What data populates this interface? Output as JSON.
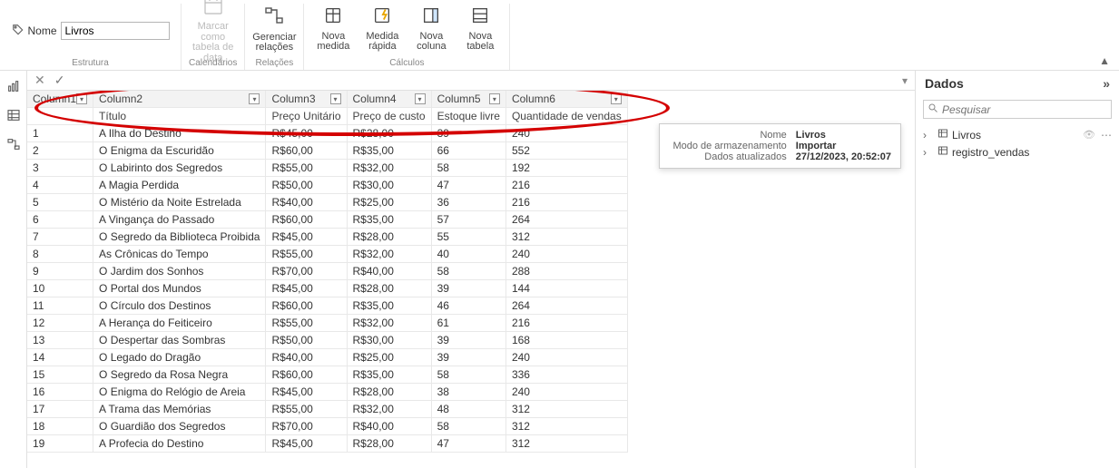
{
  "ribbon": {
    "name_label": "Nome",
    "name_value": "Livros",
    "groups": {
      "estrutura": "Estrutura",
      "calendarios": "Calendários",
      "relacoes": "Relações",
      "calculos": "Cálculos"
    },
    "buttons": {
      "marcar": "Marcar como tabela de data",
      "gerenciar": "Gerenciar relações",
      "nova_medida": "Nova medida",
      "medida_rapida": "Medida rápida",
      "nova_coluna": "Nova coluna",
      "nova_tabela": "Nova tabela"
    }
  },
  "columns": [
    "Column1",
    "Column2",
    "Column3",
    "Column4",
    "Column5",
    "Column6"
  ],
  "header_row": [
    "",
    "Título",
    "Preço Unitário",
    "Preço de custo",
    "Estoque livre",
    "Quantidade de vendas"
  ],
  "rows": [
    [
      "1",
      "A Ilha do Destino",
      "R$45,00",
      "R$28,00",
      "39",
      "240"
    ],
    [
      "2",
      "O Enigma da Escuridão",
      "R$60,00",
      "R$35,00",
      "66",
      "552"
    ],
    [
      "3",
      "O Labirinto dos Segredos",
      "R$55,00",
      "R$32,00",
      "58",
      "192"
    ],
    [
      "4",
      "A Magia Perdida",
      "R$50,00",
      "R$30,00",
      "47",
      "216"
    ],
    [
      "5",
      "O Mistério da Noite Estrelada",
      "R$40,00",
      "R$25,00",
      "36",
      "216"
    ],
    [
      "6",
      "A Vingança do Passado",
      "R$60,00",
      "R$35,00",
      "57",
      "264"
    ],
    [
      "7",
      "O Segredo da Biblioteca Proibida",
      "R$45,00",
      "R$28,00",
      "55",
      "312"
    ],
    [
      "8",
      "As Crônicas do Tempo",
      "R$55,00",
      "R$32,00",
      "40",
      "240"
    ],
    [
      "9",
      "O Jardim dos Sonhos",
      "R$70,00",
      "R$40,00",
      "58",
      "288"
    ],
    [
      "10",
      "O Portal dos Mundos",
      "R$45,00",
      "R$28,00",
      "39",
      "144"
    ],
    [
      "11",
      "O Círculo dos Destinos",
      "R$60,00",
      "R$35,00",
      "46",
      "264"
    ],
    [
      "12",
      "A Herança do Feiticeiro",
      "R$55,00",
      "R$32,00",
      "61",
      "216"
    ],
    [
      "13",
      "O Despertar das Sombras",
      "R$50,00",
      "R$30,00",
      "39",
      "168"
    ],
    [
      "14",
      "O Legado do Dragão",
      "R$40,00",
      "R$25,00",
      "39",
      "240"
    ],
    [
      "15",
      "O Segredo da Rosa Negra",
      "R$60,00",
      "R$35,00",
      "58",
      "336"
    ],
    [
      "16",
      "O Enigma do Relógio de Areia",
      "R$45,00",
      "R$28,00",
      "38",
      "240"
    ],
    [
      "17",
      "A Trama das Memórias",
      "R$55,00",
      "R$32,00",
      "48",
      "312"
    ],
    [
      "18",
      "O Guardião dos Segredos",
      "R$70,00",
      "R$40,00",
      "58",
      "312"
    ],
    [
      "19",
      "A Profecia do Destino",
      "R$45,00",
      "R$28,00",
      "47",
      "312"
    ]
  ],
  "tooltip": {
    "nome_l": "Nome",
    "nome_v": "Livros",
    "modo_l": "Modo de armazenamento",
    "modo_v": "Importar",
    "atual_l": "Dados atualizados",
    "atual_v": "27/12/2023, 20:52:07"
  },
  "dados": {
    "title": "Dados",
    "search_ph": "Pesquisar",
    "tables": [
      {
        "name": "Livros",
        "active": true
      },
      {
        "name": "registro_vendas",
        "active": false
      }
    ]
  }
}
